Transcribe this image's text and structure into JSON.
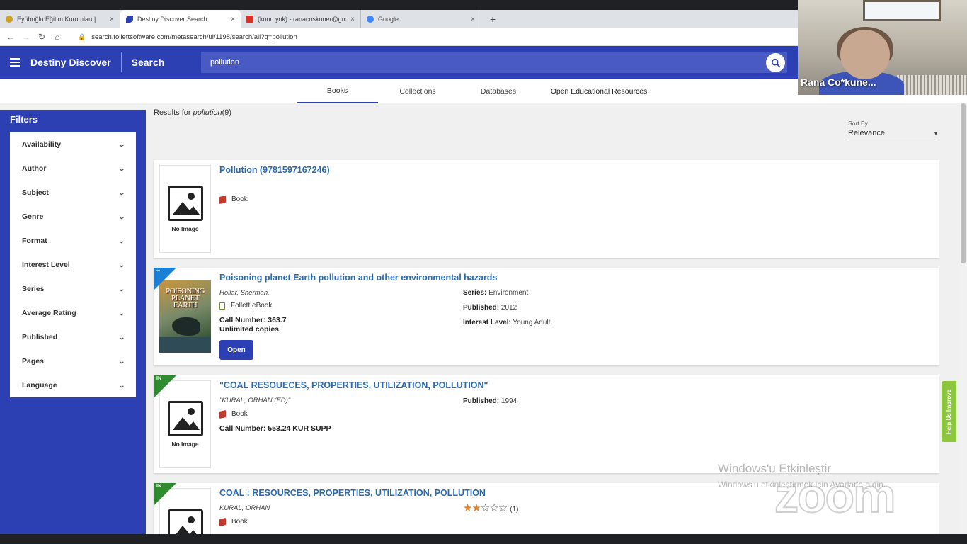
{
  "browser": {
    "tabs": [
      {
        "label": "Eyüboğlu Eğitim Kurumları |",
        "color": "#c9a227"
      },
      {
        "label": "Destiny Discover Search",
        "color": "#2c3fb3"
      },
      {
        "label": "(konu yok) - ranacoskuner@gm",
        "color": "#d93025"
      },
      {
        "label": "Google",
        "color": "#4285f4"
      }
    ],
    "new_tab": "+",
    "close_glyph": "×",
    "url": "search.follettsoftware.com/metasearch/ui/1198/search/all?q=pollution"
  },
  "header": {
    "brand": "Destiny Discover",
    "section": "Search",
    "search_value": "pollution"
  },
  "result_tabs": [
    "Books",
    "Collections",
    "Databases",
    "Open Educational Resources"
  ],
  "results": {
    "prefix": "Results for",
    "query": "pollution",
    "count": "(9)"
  },
  "sort": {
    "label": "Sort By",
    "value": "Relevance"
  },
  "filters": {
    "title": "Filters",
    "items": [
      "Availability",
      "Author",
      "Subject",
      "Genre",
      "Format",
      "Interest Level",
      "Series",
      "Average Rating",
      "Published",
      "Pages",
      "Language"
    ]
  },
  "cards": [
    {
      "title": "Pollution (9781597167246)",
      "format": "Book",
      "no_image": "No Image"
    },
    {
      "title": "Poisoning planet Earth pollution and other environmental hazards",
      "author": "Hollar, Sherman.",
      "format": "Follett eBook",
      "call_number": "Call Number: 363.7",
      "copies": "Unlimited copies",
      "open_label": "Open",
      "ribbon": "∞",
      "cover_title": "POISONING PLANET EARTH",
      "meta": [
        {
          "k": "Series:",
          "v": " Environment"
        },
        {
          "k": "Published:",
          "v": " 2012"
        },
        {
          "k": "Interest Level:",
          "v": " Young Adult"
        }
      ]
    },
    {
      "title": "\"COAL RESOUECES, PROPERTIES, UTILIZATION, POLLUTION\"",
      "author": "\"KURAL, ORHAN (ED)\"",
      "format": "Book",
      "call_number": "Call Number: 553.24 KUR SUPP",
      "ribbon": "IN",
      "no_image": "No Image",
      "meta": [
        {
          "k": "Published:",
          "v": " 1994"
        }
      ]
    },
    {
      "title": "COAL : RESOURCES, PROPERTIES, UTILIZATION, POLLUTION",
      "author": "KURAL, ORHAN",
      "format": "Book",
      "ribbon": "IN",
      "rating": 2,
      "rating_max": 5,
      "rating_count": "(1)"
    }
  ],
  "help_tab": "Help Us Improve",
  "overlay": {
    "participant_name": "Rana Co*kune...",
    "watermark_title": "Windows'u Etkinleştir",
    "watermark_sub": "Windows'u etkinleştirmek için Ayarlar'a gidin.",
    "logo": "zoom"
  }
}
